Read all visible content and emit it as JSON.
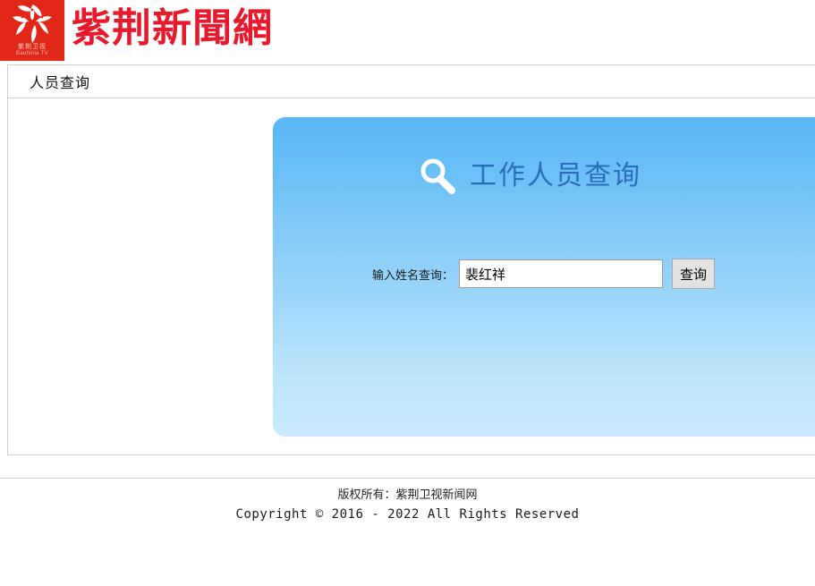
{
  "header": {
    "logo": {
      "icon": "bauhinia-flower-icon",
      "cn_text": "紫荆卫视",
      "en_text": "Bauhinia TV",
      "bg_color": "#E02718"
    },
    "site_title": "紫荆新聞網",
    "title_color": "#E8192C"
  },
  "nav": {
    "items": [
      {
        "label": "人员查询"
      }
    ]
  },
  "panel": {
    "icon": "magnifier-icon",
    "title": "工作人员查询",
    "title_color": "#2D6CBC",
    "gradient_from": "#59B7F6",
    "gradient_to": "#C8EAFC",
    "search": {
      "label": "输入姓名查询：",
      "value": "裴红祥",
      "placeholder": "",
      "button_label": "查询"
    }
  },
  "footer": {
    "copyright_cn": "版权所有：紫荆卫视新闻网",
    "copyright_en": "Copyright © 2016 - 2022 All Rights Reserved"
  }
}
